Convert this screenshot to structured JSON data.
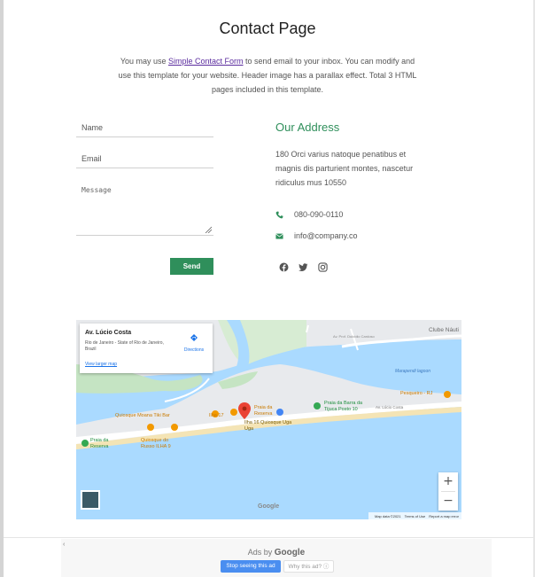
{
  "header": {
    "title": "Contact Page",
    "intro_before": "You may use ",
    "intro_link": "Simple Contact Form",
    "intro_after": " to send email to your inbox. You can modify and use this template for your website. Header image has a parallax effect. Total 3 HTML pages included in this template."
  },
  "form": {
    "name_placeholder": "Name",
    "email_placeholder": "Email",
    "message_placeholder": "Message",
    "send_label": "Send"
  },
  "address": {
    "heading": "Our Address",
    "text": "180 Orci varius natoque penatibus et magnis dis parturient montes, nascetur ridiculus mus 10550",
    "phone": "080-090-0110",
    "email": "info@company.co",
    "socials": [
      "facebook-icon",
      "twitter-icon",
      "instagram-icon"
    ]
  },
  "map": {
    "card_title": "Av. Lúcio Costa",
    "card_subtitle": "Rio de Janeiro - State of Rio de Janeiro, Brazil",
    "card_link": "View larger map",
    "directions_label": "Directions",
    "labels": {
      "clube": "Clube Náuti",
      "marapendi": "Marapendi lagoon",
      "pesqueiro": "Pesqueiro - RJ",
      "barra": "Praia da Barra da Tijuca Posto 10",
      "avlucio": "Av. Lúcio Costa",
      "reserva1": "Praia da Reserva",
      "ilha16": "Ilha 16 Quiosque Uga Uga",
      "ilha17": "Ilha 17",
      "moana": "Quiosque Moana Tiki Bar",
      "russo": "Quiosque do Russo ILHA 9",
      "reserva2": "Praia da Reserva",
      "road": "Av. Prof. Dulcídio Cardoso"
    },
    "zoom_in": "+",
    "zoom_out": "−",
    "google": "Google",
    "footer": [
      "Map data ©2021",
      "Terms of Use",
      "Report a map error"
    ]
  },
  "ads": {
    "back": "‹",
    "ads_by": "Ads by",
    "google": "Google",
    "stop": "Stop seeing this ad",
    "why": "Why this ad? ⓘ"
  },
  "colors": {
    "accent": "#2f8f5b",
    "link": "#5a2b9e",
    "water": "#aadaff",
    "map_link": "#1a73e8"
  }
}
